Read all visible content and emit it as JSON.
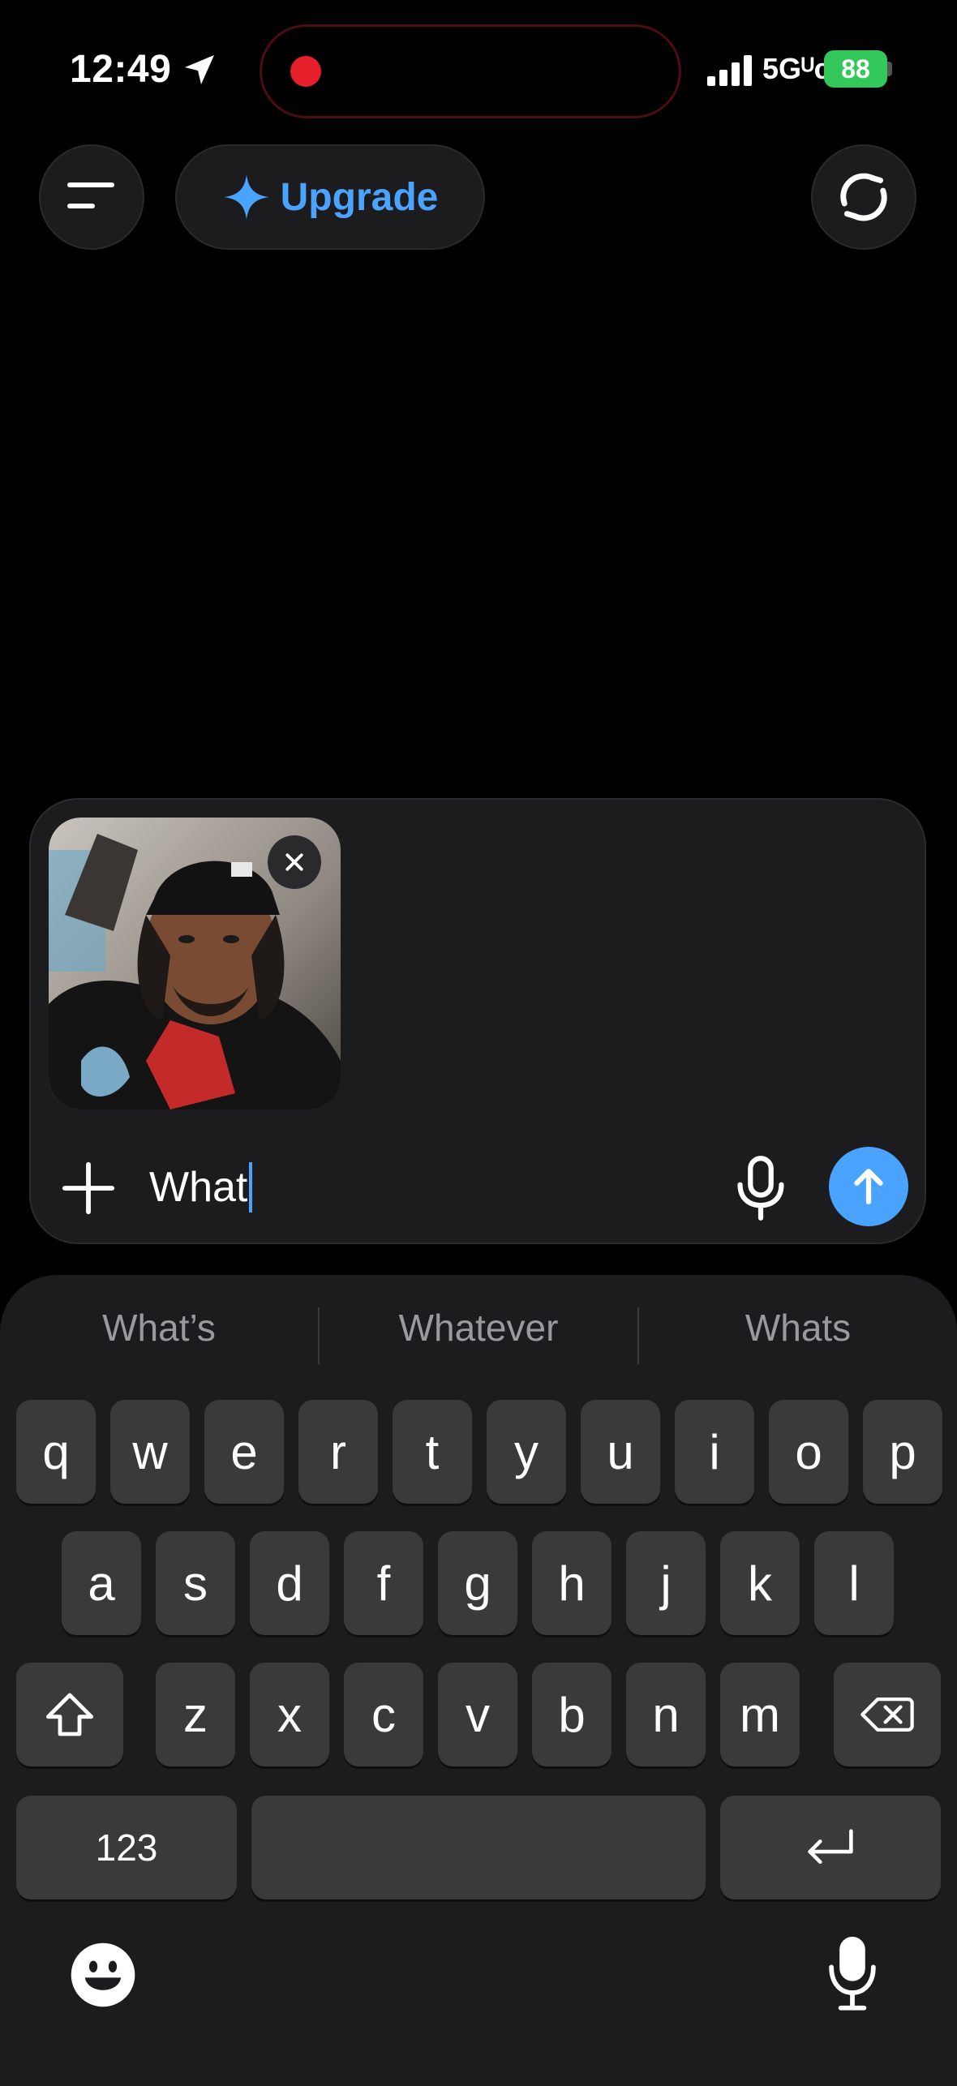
{
  "status_bar": {
    "time": "12:49",
    "network": "5Gᵁᴄ",
    "battery": "88",
    "recording_color": "#e5202a"
  },
  "header": {
    "menu_icon": "hamburger-menu-icon",
    "upgrade_label": "Upgrade",
    "upgrade_icon": "sparkle-icon",
    "sync_icon": "refresh-chat-icon",
    "accent": "#4aa3ff"
  },
  "composer": {
    "input_value": "What",
    "attachment": "photo-thumbnail",
    "add_icon": "plus-icon",
    "mic_icon": "microphone-icon",
    "send_icon": "arrow-up-icon"
  },
  "keyboard": {
    "suggestions": [
      "What’s",
      "Whatever",
      "Whats"
    ],
    "row1": [
      "q",
      "w",
      "e",
      "r",
      "t",
      "y",
      "u",
      "i",
      "o",
      "p"
    ],
    "row2": [
      "a",
      "s",
      "d",
      "f",
      "g",
      "h",
      "j",
      "k",
      "l"
    ],
    "row3": [
      "z",
      "x",
      "c",
      "v",
      "b",
      "n",
      "m"
    ],
    "numbers_label": "123"
  }
}
